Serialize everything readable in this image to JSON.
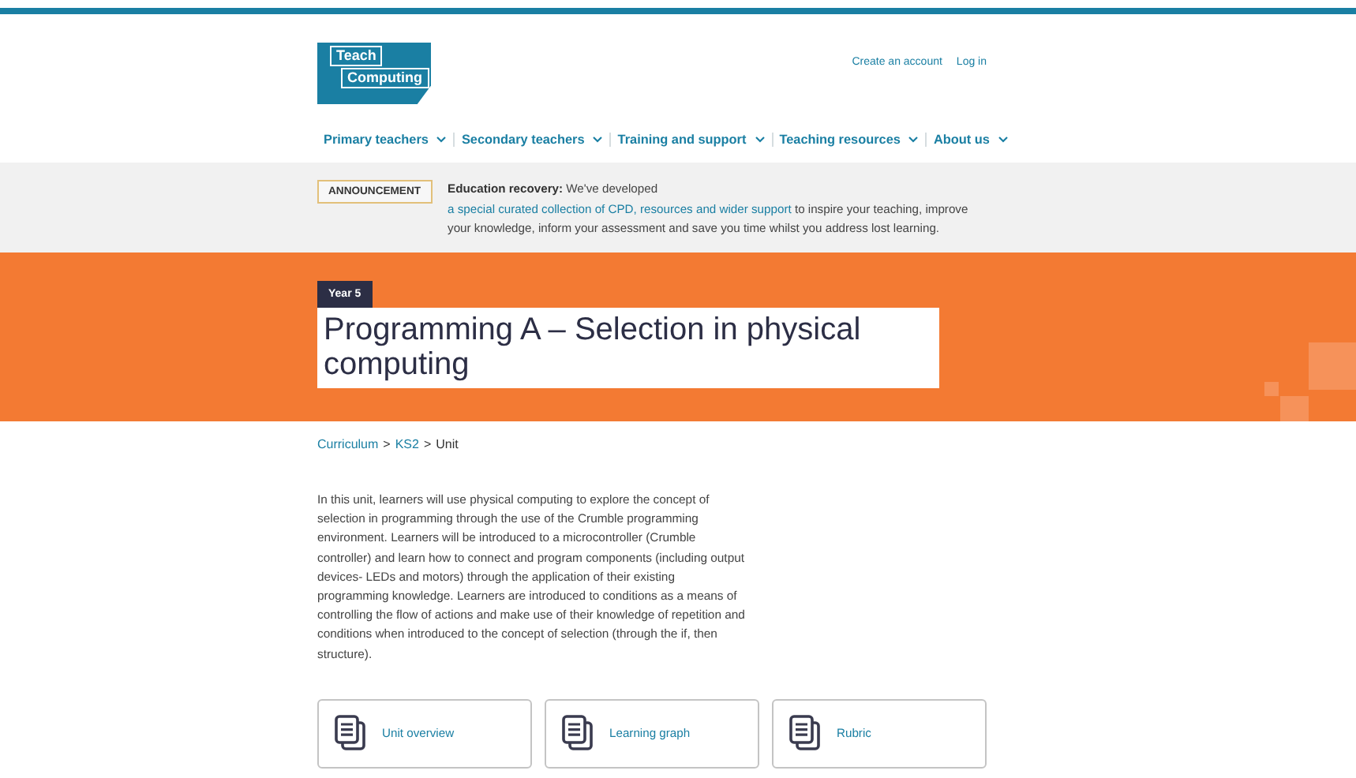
{
  "header": {
    "logo": [
      "Teach",
      "Computing"
    ],
    "account_links": [
      "Create an account",
      "Log in"
    ]
  },
  "nav": [
    {
      "label": "Primary teachers"
    },
    {
      "label": "Secondary teachers"
    },
    {
      "label": "Training and support"
    },
    {
      "label": "Teaching resources"
    },
    {
      "label": "About us"
    }
  ],
  "announcement": {
    "badge": "ANNOUNCEMENT",
    "lead": "Education recovery:",
    "before": " We've developed ",
    "link": "a special curated collection of CPD, resources and wider support",
    "after": " to inspire your teaching, improve your knowledge, inform your assessment and save you time whilst you address lost learning."
  },
  "hero": {
    "tag": "Year 5",
    "title": "Programming A – Selection in physical computing"
  },
  "breadcrumb": {
    "separator": ">",
    "items": [
      {
        "label": "Curriculum",
        "link": true
      },
      {
        "label": "KS2",
        "link": true
      },
      {
        "label": "Unit",
        "link": false
      }
    ]
  },
  "description": "In this unit, learners will use physical computing to explore the concept of selection in programming through the use of the Crumble programming environment. Learners will be introduced to a microcontroller (Crumble controller) and learn how to connect and program components (including output devices- LEDs and motors) through the application of their existing programming knowledge. Learners are introduced to conditions as a means of controlling the flow of actions and make use of their knowledge of repetition and conditions when introduced to the concept of selection (through the if, then structure).",
  "resources": [
    {
      "label": "Unit overview"
    },
    {
      "label": "Learning graph"
    },
    {
      "label": "Rubric"
    }
  ]
}
